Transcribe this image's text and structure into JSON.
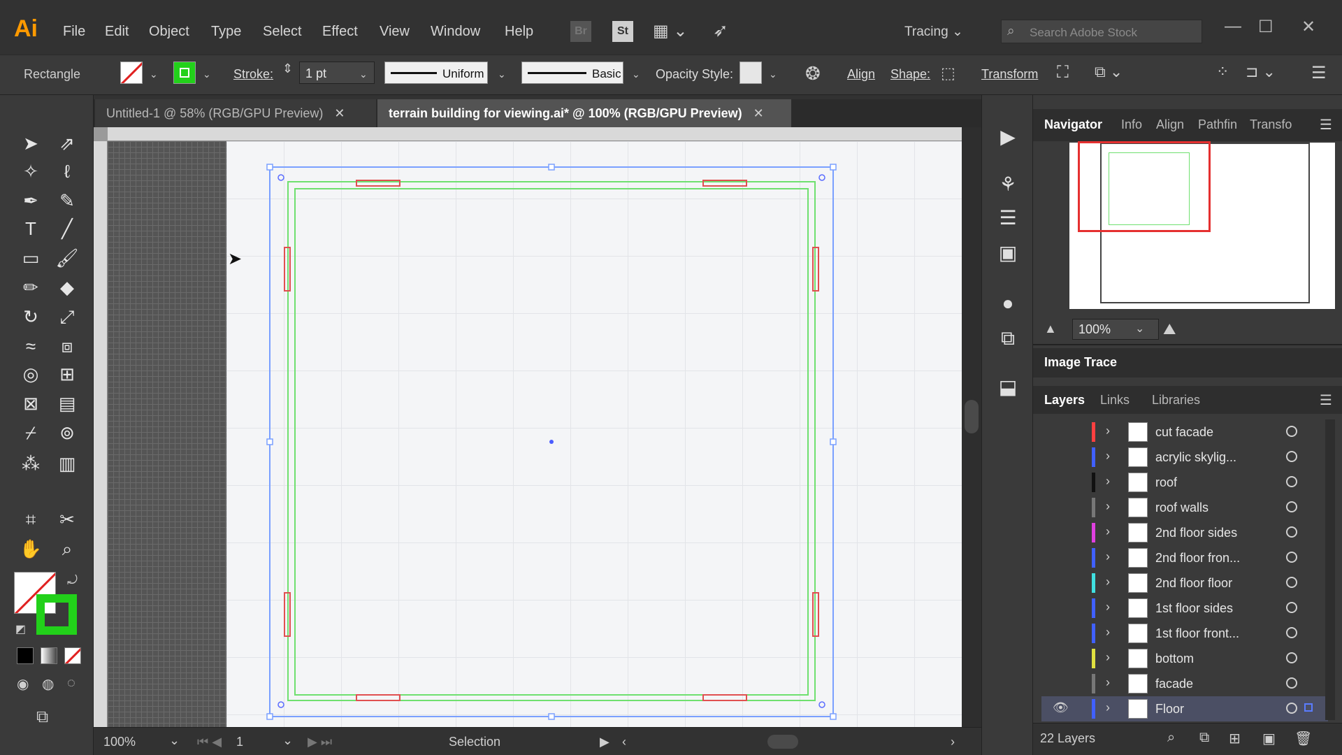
{
  "app": {
    "logo": "Ai"
  },
  "menu": [
    "File",
    "Edit",
    "Object",
    "Type",
    "Select",
    "Effect",
    "View",
    "Window",
    "Help"
  ],
  "menubar_extras": {
    "br": "Br",
    "st": "St",
    "workspace": "Tracing",
    "search_placeholder": "Search Adobe Stock"
  },
  "controlbar": {
    "tool_name": "Rectangle",
    "stroke_label": "Stroke:",
    "stroke_value": "1 pt",
    "profile_uniform": "Uniform",
    "brush_basic": "Basic",
    "opacity_label": "Opacity",
    "style_label": "Style:",
    "align_label": "Align",
    "shape_label": "Shape:",
    "transform_label": "Transform",
    "stroke_color": "#22d11a"
  },
  "tabs": [
    {
      "label": "Untitled-1 @ 58% (RGB/GPU Preview)",
      "active": false
    },
    {
      "label": "terrain building for viewing.ai* @ 100% (RGB/GPU Preview)",
      "active": true
    }
  ],
  "status": {
    "zoom": "100%",
    "artboard": "1",
    "tool": "Selection"
  },
  "panels": {
    "nav_tabs": [
      "Navigator",
      "Info",
      "Align",
      "Pathfin",
      "Transfo"
    ],
    "nav_zoom": "100%",
    "image_trace": "Image Trace",
    "layer_tabs": [
      "Layers",
      "Links",
      "Libraries"
    ],
    "layers_count": "22 Layers"
  },
  "layers": [
    {
      "name": "cut facade",
      "color": "#ff4040"
    },
    {
      "name": "acrylic skylig...",
      "color": "#4060ff"
    },
    {
      "name": "roof",
      "color": "#111111"
    },
    {
      "name": "roof walls",
      "color": "#777777"
    },
    {
      "name": "2nd floor sides",
      "color": "#e040e0"
    },
    {
      "name": "2nd floor fron...",
      "color": "#4060ff"
    },
    {
      "name": "2nd floor floor",
      "color": "#40e0e0"
    },
    {
      "name": "1st floor sides",
      "color": "#4060ff"
    },
    {
      "name": "1st floor front...",
      "color": "#4060ff"
    },
    {
      "name": "bottom",
      "color": "#e0e040"
    },
    {
      "name": "facade",
      "color": "#777777"
    },
    {
      "name": "Floor",
      "color": "#4060ff"
    }
  ],
  "colors": {
    "accent_green": "#22d11a",
    "selection_blue": "#5a7cff",
    "guide_red": "#e05050"
  }
}
